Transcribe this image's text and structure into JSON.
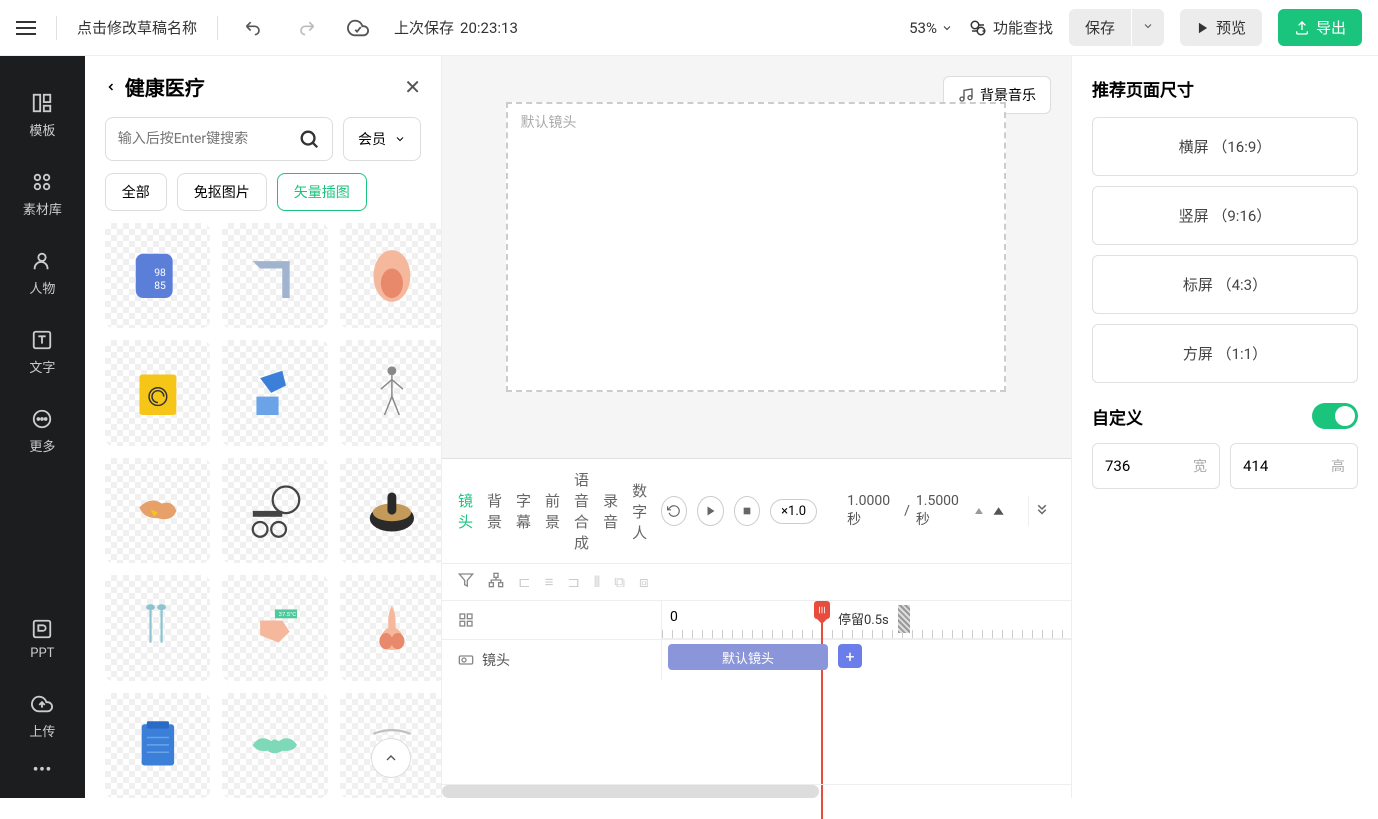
{
  "topbar": {
    "draft_name": "点击修改草稿名称",
    "last_save_label": "上次保存",
    "last_save_time": "20:23:13",
    "zoom": "53%",
    "feature_search": "功能查找",
    "save": "保存",
    "preview": "预览",
    "export": "导出"
  },
  "sidebar": {
    "items": [
      {
        "label": "模板"
      },
      {
        "label": "素材库"
      },
      {
        "label": "人物"
      },
      {
        "label": "文字"
      },
      {
        "label": "更多"
      },
      {
        "label": "PPT"
      },
      {
        "label": "上传"
      }
    ]
  },
  "asset_panel": {
    "title": "健康医疗",
    "search_placeholder": "输入后按Enter键搜索",
    "member": "会员",
    "tabs": {
      "all": "全部",
      "cutout": "免抠图片",
      "vector": "矢量插图"
    }
  },
  "canvas": {
    "bg_music": "背景音乐",
    "default_shot": "默认镜头"
  },
  "timeline": {
    "tabs": {
      "shot": "镜头",
      "bg": "背景",
      "subtitle": "字幕",
      "fg": "前景",
      "tts": "语音合成",
      "record": "录音",
      "digital": "数字人"
    },
    "speed": "×1.0",
    "time_current": "1.0000 秒",
    "time_total": "1.5000 秒",
    "ruler_zero": "0",
    "stay": "停留0.5s",
    "track_label": "镜头",
    "clip_label": "默认镜头"
  },
  "right_panel": {
    "title": "推荐页面尺寸",
    "options": [
      {
        "label": "横屏 （16:9）"
      },
      {
        "label": "竖屏 （9:16）"
      },
      {
        "label": "标屏 （4:3）"
      },
      {
        "label": "方屏 （1:1）"
      }
    ],
    "custom_label": "自定义",
    "width": "736",
    "width_label": "宽",
    "height": "414",
    "height_label": "高"
  }
}
